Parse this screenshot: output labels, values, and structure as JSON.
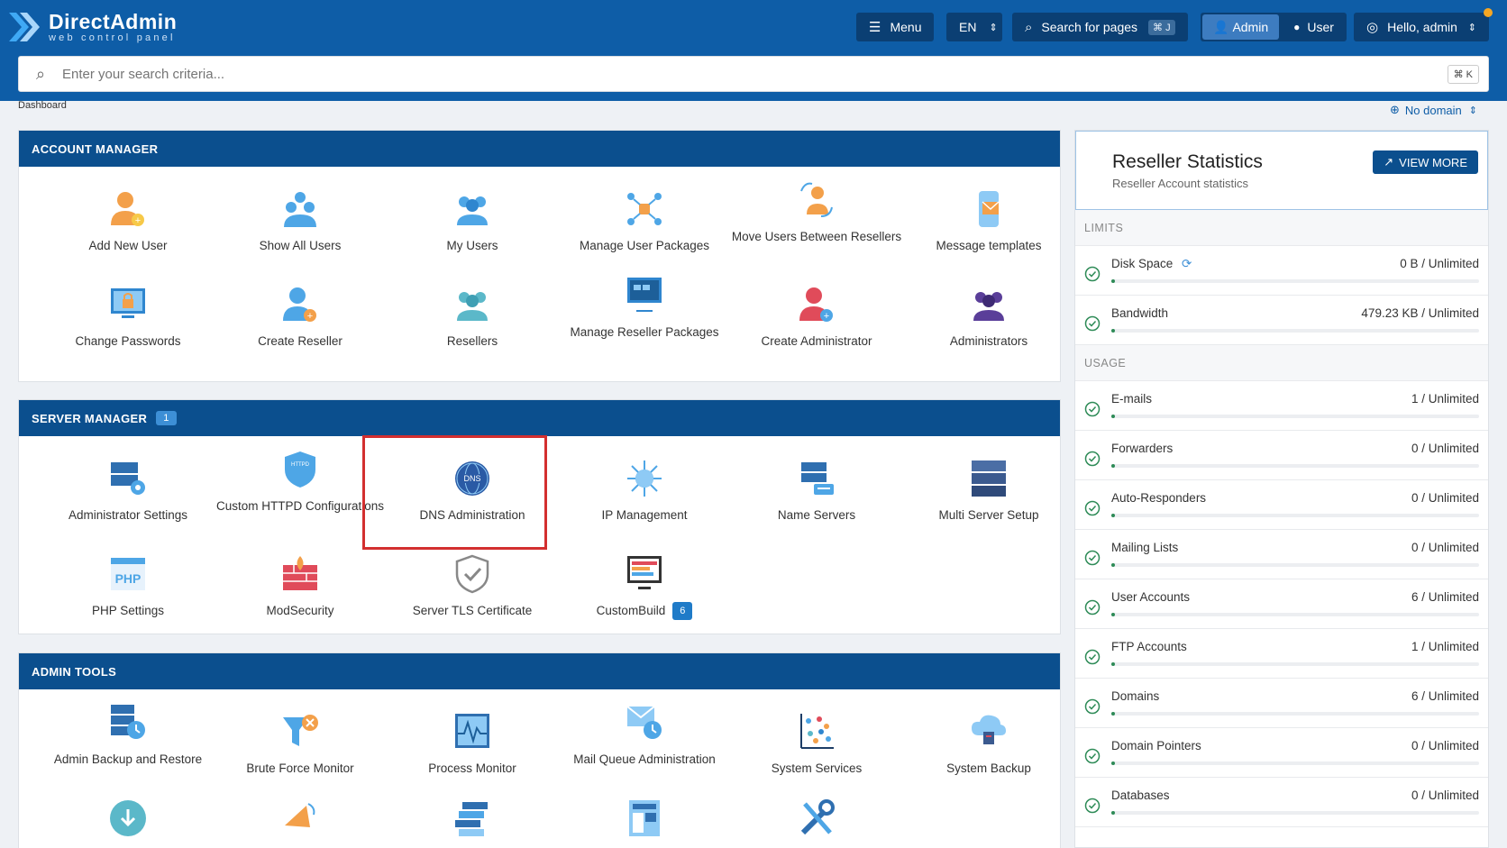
{
  "app": {
    "title": "DirectAdmin",
    "subtitle": "web control panel"
  },
  "topbar": {
    "menu_label": "Menu",
    "lang_label": "EN",
    "search_label": "Search for pages",
    "search_kbd": "⌘ J",
    "mode_admin": "Admin",
    "mode_user": "User",
    "greeting": "Hello, admin"
  },
  "search": {
    "placeholder": "Enter your search criteria...",
    "kbd": "⌘ K"
  },
  "breadcrumb": "Dashboard",
  "domain_selector": "No domain",
  "account_manager": {
    "title": "ACCOUNT MANAGER",
    "items": [
      "Add New User",
      "Show All Users",
      "My Users",
      "Manage User Packages",
      "Move Users Between Resellers",
      "Message templates",
      "Change Passwords",
      "Create Reseller",
      "Resellers",
      "Manage Reseller Packages",
      "Create Administrator",
      "Administrators"
    ]
  },
  "server_manager": {
    "title": "SERVER MANAGER",
    "badge": "1",
    "items": [
      "Administrator Settings",
      "Custom HTTPD Configurations",
      "DNS Administration",
      "IP Management",
      "Name Servers",
      "Multi Server Setup",
      "PHP Settings",
      "ModSecurity",
      "Server TLS Certificate",
      "CustomBuild"
    ],
    "custombuild_badge": "6"
  },
  "admin_tools": {
    "title": "ADMIN TOOLS",
    "items": [
      "Admin Backup and Restore",
      "Brute Force Monitor",
      "Process Monitor",
      "Mail Queue Administration",
      "System Services",
      "System Backup"
    ]
  },
  "stats": {
    "title": "Reseller Statistics",
    "subtitle": "Reseller Account statistics",
    "view_more": "VIEW MORE",
    "limits_label": "LIMITS",
    "usage_label": "USAGE",
    "limits": [
      {
        "name": "Disk Space",
        "value": "0 B / Unlimited"
      },
      {
        "name": "Bandwidth",
        "value": "479.23 KB / Unlimited"
      }
    ],
    "usage": [
      {
        "name": "E-mails",
        "value": "1 / Unlimited"
      },
      {
        "name": "Forwarders",
        "value": "0 / Unlimited"
      },
      {
        "name": "Auto-Responders",
        "value": "0 / Unlimited"
      },
      {
        "name": "Mailing Lists",
        "value": "0 / Unlimited"
      },
      {
        "name": "User Accounts",
        "value": "6 / Unlimited"
      },
      {
        "name": "FTP Accounts",
        "value": "1 / Unlimited"
      },
      {
        "name": "Domains",
        "value": "6 / Unlimited"
      },
      {
        "name": "Domain Pointers",
        "value": "0 / Unlimited"
      },
      {
        "name": "Databases",
        "value": "0 / Unlimited"
      }
    ]
  },
  "colors": {
    "brand": "#0e5da7",
    "panel_head": "#0b4f8e",
    "highlight": "#d32f2f",
    "accent_orange": "#f5a623"
  }
}
